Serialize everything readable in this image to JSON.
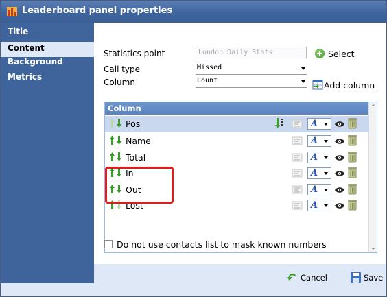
{
  "window": {
    "title": "Leaderboard panel properties",
    "title_icon": "leaderboard-icon"
  },
  "sidebar": {
    "items": [
      {
        "label": "Title",
        "active": false
      },
      {
        "label": "Content",
        "active": true
      },
      {
        "label": "Background",
        "active": false
      },
      {
        "label": "Metrics",
        "active": false
      }
    ]
  },
  "form": {
    "statistics_point": {
      "label": "Statistics point",
      "value": "London Daily Stats",
      "disabled": true
    },
    "select_button": {
      "label": "Select",
      "icon": "add-icon"
    },
    "call_type": {
      "label": "Call type",
      "value": "Missed"
    },
    "column": {
      "label": "Column",
      "value": "Count"
    },
    "add_column_button": {
      "label": "Add column",
      "icon": "add-column-icon"
    }
  },
  "grid": {
    "header": "Column",
    "rows": [
      {
        "label": "Pos",
        "up_enabled": false,
        "down_enabled": true,
        "selected": true,
        "sort_icon": true
      },
      {
        "label": "Name",
        "up_enabled": true,
        "down_enabled": true,
        "selected": false,
        "sort_icon": false
      },
      {
        "label": "Total",
        "up_enabled": true,
        "down_enabled": true,
        "selected": false,
        "sort_icon": false
      },
      {
        "label": "In",
        "up_enabled": true,
        "down_enabled": true,
        "selected": false,
        "sort_icon": false
      },
      {
        "label": "Out",
        "up_enabled": true,
        "down_enabled": true,
        "selected": false,
        "sort_icon": false
      },
      {
        "label": "Lost",
        "up_enabled": true,
        "down_enabled": false,
        "selected": false,
        "sort_icon": false
      }
    ],
    "highlighted_rows": [
      "Total",
      "In"
    ]
  },
  "checkbox": {
    "label": "Do not use contacts list to mask known numbers",
    "checked": false
  },
  "footer": {
    "cancel_label": "Cancel",
    "save_label": "Save"
  },
  "colors": {
    "titlebar": "#3f659e",
    "sidebar": "#3f649c",
    "grid_header": "#5a83c0",
    "highlight": "#e01b1b",
    "arrow_green": "#3a9b2a"
  }
}
